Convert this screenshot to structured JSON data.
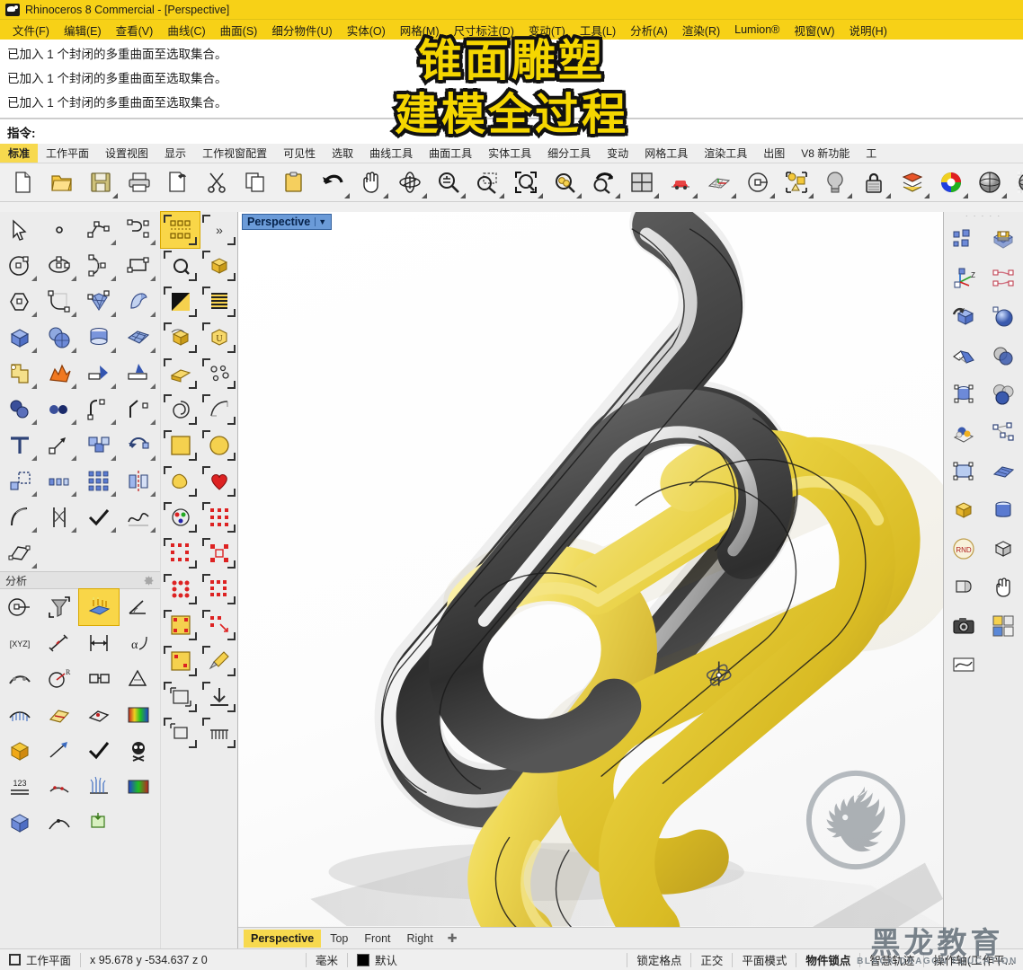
{
  "window": {
    "title": "Rhinoceros 8 Commercial - [Perspective]",
    "logo_icon": "rhino-head-icon"
  },
  "menubar": {
    "items": [
      {
        "label": "文件(F)",
        "name": "menu-file"
      },
      {
        "label": "编辑(E)",
        "name": "menu-edit"
      },
      {
        "label": "查看(V)",
        "name": "menu-view"
      },
      {
        "label": "曲线(C)",
        "name": "menu-curve"
      },
      {
        "label": "曲面(S)",
        "name": "menu-surface"
      },
      {
        "label": "细分物件(U)",
        "name": "menu-subd"
      },
      {
        "label": "实体(O)",
        "name": "menu-solid"
      },
      {
        "label": "网格(M)",
        "name": "menu-mesh"
      },
      {
        "label": "尺寸标注(D)",
        "name": "menu-dimension"
      },
      {
        "label": "变动(T)",
        "name": "menu-transform"
      },
      {
        "label": "工具(L)",
        "name": "menu-tools"
      },
      {
        "label": "分析(A)",
        "name": "menu-analyze"
      },
      {
        "label": "渲染(R)",
        "name": "menu-render"
      },
      {
        "label": "Lumion®",
        "name": "menu-lumion"
      },
      {
        "label": "视窗(W)",
        "name": "menu-window"
      },
      {
        "label": "说明(H)",
        "name": "menu-help"
      }
    ]
  },
  "command_area": {
    "history": [
      "已加入 1 个封闭的多重曲面至选取集合。",
      "已加入 1 个封闭的多重曲面至选取集合。",
      "已加入 1 个封闭的多重曲面至选取集合。"
    ],
    "prompt_label": "指令:",
    "prompt_value": "",
    "prompt_placeholder": ""
  },
  "toolbar_tabs": {
    "active": "标准",
    "items": [
      {
        "label": "标准",
        "name": "tab-standard"
      },
      {
        "label": "工作平面",
        "name": "tab-cplane"
      },
      {
        "label": "设置视图",
        "name": "tab-set-view"
      },
      {
        "label": "显示",
        "name": "tab-display"
      },
      {
        "label": "工作视窗配置",
        "name": "tab-viewport-layout"
      },
      {
        "label": "可见性",
        "name": "tab-visibility"
      },
      {
        "label": "选取",
        "name": "tab-select"
      },
      {
        "label": "曲线工具",
        "name": "tab-curve-tools"
      },
      {
        "label": "曲面工具",
        "name": "tab-surface-tools"
      },
      {
        "label": "实体工具",
        "name": "tab-solid-tools"
      },
      {
        "label": "细分工具",
        "name": "tab-subd-tools"
      },
      {
        "label": "变动",
        "name": "tab-transform"
      },
      {
        "label": "网格工具",
        "name": "tab-mesh-tools"
      },
      {
        "label": "渲染工具",
        "name": "tab-render-tools"
      },
      {
        "label": "出图",
        "name": "tab-drafting"
      },
      {
        "label": "V8 新功能",
        "name": "tab-v8-new"
      },
      {
        "label": "工",
        "name": "tab-overflow"
      }
    ]
  },
  "main_toolbar": {
    "buttons": [
      {
        "name": "new-file-icon",
        "tip": "新建",
        "flyout": false
      },
      {
        "name": "open-file-icon",
        "tip": "开启",
        "flyout": false
      },
      {
        "name": "save-file-icon",
        "tip": "储存",
        "flyout": true
      },
      {
        "name": "print-icon",
        "tip": "打印",
        "flyout": false
      },
      {
        "name": "copy-to-clipboard-icon",
        "tip": "复制到剪贴板",
        "flyout": false
      },
      {
        "name": "cut-icon",
        "tip": "剪下",
        "flyout": false
      },
      {
        "name": "copy-icon",
        "tip": "复制",
        "flyout": false
      },
      {
        "name": "paste-icon",
        "tip": "贴上",
        "flyout": false
      },
      {
        "name": "undo-icon",
        "tip": "复原",
        "flyout": true
      },
      {
        "name": "pan-hand-icon",
        "tip": "平移",
        "flyout": true
      },
      {
        "name": "rotate-view-icon",
        "tip": "旋转视图",
        "flyout": true
      },
      {
        "name": "zoom-in-out-icon",
        "tip": "缩放",
        "flyout": true
      },
      {
        "name": "zoom-window-icon",
        "tip": "框选缩放",
        "flyout": true
      },
      {
        "name": "zoom-extents-icon",
        "tip": "缩放至最大范围",
        "flyout": true
      },
      {
        "name": "zoom-selected-icon",
        "tip": "缩放至选取物件",
        "flyout": true
      },
      {
        "name": "zoom-previous-icon",
        "tip": "回到前一个视图",
        "flyout": true
      },
      {
        "name": "four-viewport-icon",
        "tip": "四个工作视窗",
        "flyout": true
      },
      {
        "name": "perspective-view-icon",
        "tip": "透视图",
        "flyout": true
      },
      {
        "name": "cplane-grid-icon",
        "tip": "工作平面",
        "flyout": true
      },
      {
        "name": "object-properties-icon",
        "tip": "物件属性",
        "flyout": true
      },
      {
        "name": "select-objects-icon",
        "tip": "选取物件",
        "flyout": true
      },
      {
        "name": "light-bulb-icon",
        "tip": "灯光",
        "flyout": true
      },
      {
        "name": "lock-icon",
        "tip": "锁定物件",
        "flyout": true
      },
      {
        "name": "layers-icon",
        "tip": "图层",
        "flyout": true
      },
      {
        "name": "color-wheel-icon",
        "tip": "颜色",
        "flyout": true
      },
      {
        "name": "shaded-sphere-icon",
        "tip": "着色模式",
        "flyout": true
      },
      {
        "name": "render-sphere-icon",
        "tip": "渲染模式",
        "flyout": true
      }
    ]
  },
  "left_palette": {
    "buttons": [
      {
        "name": "select-arrow-icon",
        "flyout": false
      },
      {
        "name": "point-icon",
        "flyout": false
      },
      {
        "name": "polyline-icon",
        "flyout": true
      },
      {
        "name": "curve-interpolate-icon",
        "flyout": true
      },
      {
        "name": "circle-icon",
        "flyout": true
      },
      {
        "name": "ellipse-icon",
        "flyout": true
      },
      {
        "name": "arc-icon",
        "flyout": true
      },
      {
        "name": "rectangle-icon",
        "flyout": true
      },
      {
        "name": "polygon-icon",
        "flyout": true
      },
      {
        "name": "fillet-curve-icon",
        "flyout": true
      },
      {
        "name": "surface-control-points-icon",
        "flyout": true
      },
      {
        "name": "extrude-surface-icon",
        "flyout": true
      },
      {
        "name": "box-solid-icon",
        "flyout": true
      },
      {
        "name": "sphere-solid-icon",
        "flyout": true
      },
      {
        "name": "cylinder-solid-icon",
        "flyout": true
      },
      {
        "name": "surface-patch-icon",
        "flyout": true
      },
      {
        "name": "boolean-union-icon",
        "flyout": true
      },
      {
        "name": "explode-icon",
        "flyout": true
      },
      {
        "name": "trim-icon",
        "flyout": true
      },
      {
        "name": "split-icon",
        "flyout": true
      },
      {
        "name": "offset-icon",
        "flyout": true
      },
      {
        "name": "offset-surface-icon",
        "flyout": true
      },
      {
        "name": "fillet-edge-icon",
        "flyout": true
      },
      {
        "name": "chamfer-icon",
        "flyout": true
      },
      {
        "name": "text-icon",
        "flyout": true
      },
      {
        "name": "move-icon",
        "flyout": true
      },
      {
        "name": "copy-object-icon",
        "flyout": true
      },
      {
        "name": "rotate-object-icon",
        "flyout": true
      },
      {
        "name": "scale-icon",
        "flyout": true
      },
      {
        "name": "array-linear-icon",
        "flyout": true
      },
      {
        "name": "array-grid-icon",
        "flyout": true
      },
      {
        "name": "mirror-icon",
        "flyout": true
      },
      {
        "name": "bend-icon",
        "flyout": true
      },
      {
        "name": "twist-icon",
        "flyout": true
      },
      {
        "name": "check-object-icon",
        "flyout": true
      },
      {
        "name": "smooth-icon",
        "flyout": true
      },
      {
        "name": "plane-from-points-icon",
        "flyout": true
      }
    ]
  },
  "analysis_panel": {
    "title": "分析",
    "gear_icon": "gear-icon",
    "buttons": [
      {
        "name": "center-mark-icon"
      },
      {
        "name": "filter-funnel-icon",
        "selected": false
      },
      {
        "name": "zebra-analysis-icon",
        "selected": true
      },
      {
        "name": "angle-measure-icon"
      },
      {
        "name": "xyz-point-icon"
      },
      {
        "name": "distance-measure-icon"
      },
      {
        "name": "length-measure-icon"
      },
      {
        "name": "alpha-curvature-icon"
      },
      {
        "name": "curve-deviation-icon"
      },
      {
        "name": "radius-icon"
      },
      {
        "name": "surface-area-icon"
      },
      {
        "name": "draft-angle-icon"
      },
      {
        "name": "curvature-graph-icon"
      },
      {
        "name": "section-icon"
      },
      {
        "name": "planarity-icon"
      },
      {
        "name": "color-gradient-icon"
      },
      {
        "name": "geometry-inspect-icon"
      },
      {
        "name": "direction-icon"
      },
      {
        "name": "check-mark-icon"
      },
      {
        "name": "bad-object-icon"
      },
      {
        "name": "numbers-icon"
      },
      {
        "name": "point-deviation-icon"
      },
      {
        "name": "hair-analysis-icon"
      },
      {
        "name": "histogram-icon"
      },
      {
        "name": "mesh-repair-icon"
      },
      {
        "name": "curve-tangent-icon"
      },
      {
        "name": "extract-icon"
      }
    ]
  },
  "column_toolbar": {
    "header_selected": true,
    "expand_label": "»",
    "buttons": [
      {
        "name": "control-points-on-icon",
        "selected": true
      },
      {
        "name": "expand-toolbar-icon",
        "selected": false
      },
      {
        "name": "zoom-extents-sel-icon"
      },
      {
        "name": "subd-box-icon"
      },
      {
        "name": "half-tone-icon"
      },
      {
        "name": "stripes-icon"
      },
      {
        "name": "subd-smooth-icon"
      },
      {
        "name": "subd-uv-icon"
      },
      {
        "name": "subd-slice-icon"
      },
      {
        "name": "dots-circles-icon"
      },
      {
        "name": "subd-spiral-icon"
      },
      {
        "name": "subd-curve-icon"
      },
      {
        "name": "subd-sphere-icon"
      },
      {
        "name": "subd-plane-icon"
      },
      {
        "name": "square-sel-icon"
      },
      {
        "name": "circle-sel-icon"
      },
      {
        "name": "blob-icon"
      },
      {
        "name": "heart-icon"
      },
      {
        "name": "palette-icon"
      },
      {
        "name": "red-grid-icon"
      },
      {
        "name": "red-dots-a-icon"
      },
      {
        "name": "red-dots-b-icon"
      },
      {
        "name": "red-grid-sel-icon"
      },
      {
        "name": "red-grid-arrow-icon"
      },
      {
        "name": "square-grid-icon"
      },
      {
        "name": "brush-icon"
      },
      {
        "name": "corner-box-icon"
      },
      {
        "name": "download-arrow-icon"
      },
      {
        "name": "small-box-icon"
      },
      {
        "name": "rake-icon"
      }
    ]
  },
  "right_toolbar": {
    "buttons": [
      {
        "name": "group-objects-icon"
      },
      {
        "name": "save-small-icon"
      },
      {
        "name": "gumball-axis-icon"
      },
      {
        "name": "curve-network-icon"
      },
      {
        "name": "orient-3point-icon"
      },
      {
        "name": "sphere-shade-icon"
      },
      {
        "name": "flow-along-surface-icon"
      },
      {
        "name": "boolean-ops-icon"
      },
      {
        "name": "cylinder-cage-icon"
      },
      {
        "name": "boolean-union-2-icon"
      },
      {
        "name": "sphere-pile-icon"
      },
      {
        "name": "nodes-icon"
      },
      {
        "name": "transform-rect-icon"
      },
      {
        "name": "surface-sel-icon"
      },
      {
        "name": "extrude-box-icon"
      },
      {
        "name": "cylinder-icon"
      },
      {
        "name": "rnd-random-icon"
      },
      {
        "name": "iso-box-icon"
      },
      {
        "name": "unroll-icon"
      },
      {
        "name": "pan-view-icon"
      },
      {
        "name": "camera-icon"
      },
      {
        "name": "four-pane-icon"
      },
      {
        "name": "curve-graph-icon"
      }
    ]
  },
  "viewport": {
    "label": "Perspective",
    "caret_icon": "chevron-down-icon",
    "tabs": [
      {
        "label": "Perspective",
        "active": true,
        "name": "viewport-tab-perspective"
      },
      {
        "label": "Top",
        "active": false,
        "name": "viewport-tab-top"
      },
      {
        "label": "Front",
        "active": false,
        "name": "viewport-tab-front"
      },
      {
        "label": "Right",
        "active": false,
        "name": "viewport-tab-right"
      }
    ],
    "add_tab_icon": "add-viewport-icon",
    "model": {
      "description": "两个互锁的圆角矩形环形雕塑",
      "object_a_color": "#3a3a3a",
      "object_b_color": "#e8c93a",
      "gumball_icon": "gumball-cursor-icon"
    }
  },
  "statusbar": {
    "cplane_icon": "cplane-icon",
    "cplane_label": "工作平面",
    "coordinates": "x 95.678  y -534.637  z 0",
    "units": "毫米",
    "layer_swatch_color": "#000000",
    "layer_name": "默认",
    "toggles": [
      {
        "label": "锁定格点",
        "active": false,
        "name": "status-snap-grid"
      },
      {
        "label": "正交",
        "active": false,
        "name": "status-ortho"
      },
      {
        "label": "平面模式",
        "active": false,
        "name": "status-planar"
      },
      {
        "label": "物件锁点",
        "active": true,
        "name": "status-osnap"
      },
      {
        "label": "智慧轨迹",
        "active": false,
        "name": "status-smarttrack"
      },
      {
        "label": "操作轴(工作平...",
        "active": false,
        "name": "status-gumball"
      }
    ]
  },
  "overlays": {
    "title_line1": "锥面雕塑",
    "title_line2": "建模全过程",
    "watermark_cn": "黑龙教育",
    "watermark_en": "BLACK DRAGON EDUCATION",
    "watermark_logo_icon": "dragon-head-logo-icon"
  },
  "colors": {
    "title_bar": "#f7d117",
    "accent_yellow": "#f7d94e",
    "viewport_bg": "#ffffff",
    "panel_bg": "#ececec",
    "selection_blue": "#6b9bd8"
  }
}
